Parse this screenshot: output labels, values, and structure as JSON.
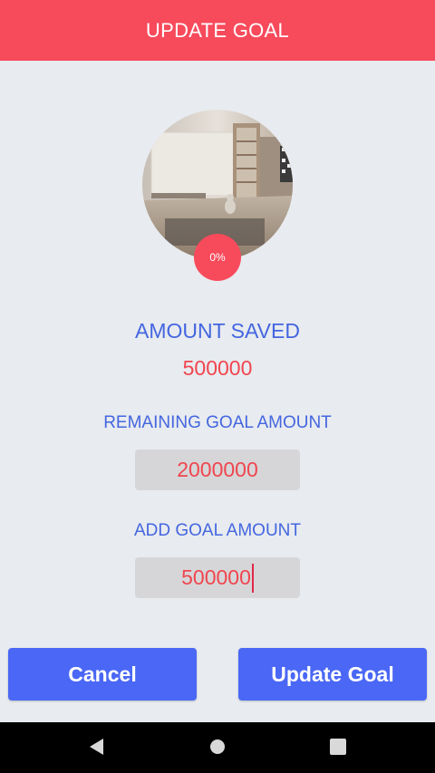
{
  "header": {
    "title": "UPDATE GOAL",
    "color": "#f74a5b"
  },
  "goal": {
    "image_icon": "living-room-photo",
    "progress_label": "0%",
    "progress_percent": 0
  },
  "amount_saved": {
    "label": "AMOUNT SAVED",
    "value": "500000"
  },
  "remaining": {
    "label": "REMAINING GOAL AMOUNT",
    "value": "2000000"
  },
  "add_goal": {
    "label": "ADD GOAL AMOUNT",
    "value": "500000"
  },
  "actions": {
    "cancel_label": "Cancel",
    "update_label": "Update Goal",
    "button_color": "#4a67f5"
  },
  "system_nav": {
    "back_icon": "back-triangle-icon",
    "home_icon": "home-circle-icon",
    "recent_icon": "recent-apps-square-icon"
  },
  "colors": {
    "label_blue": "#4466e0",
    "value_red": "#f0454f",
    "background": "#e8ebef"
  }
}
